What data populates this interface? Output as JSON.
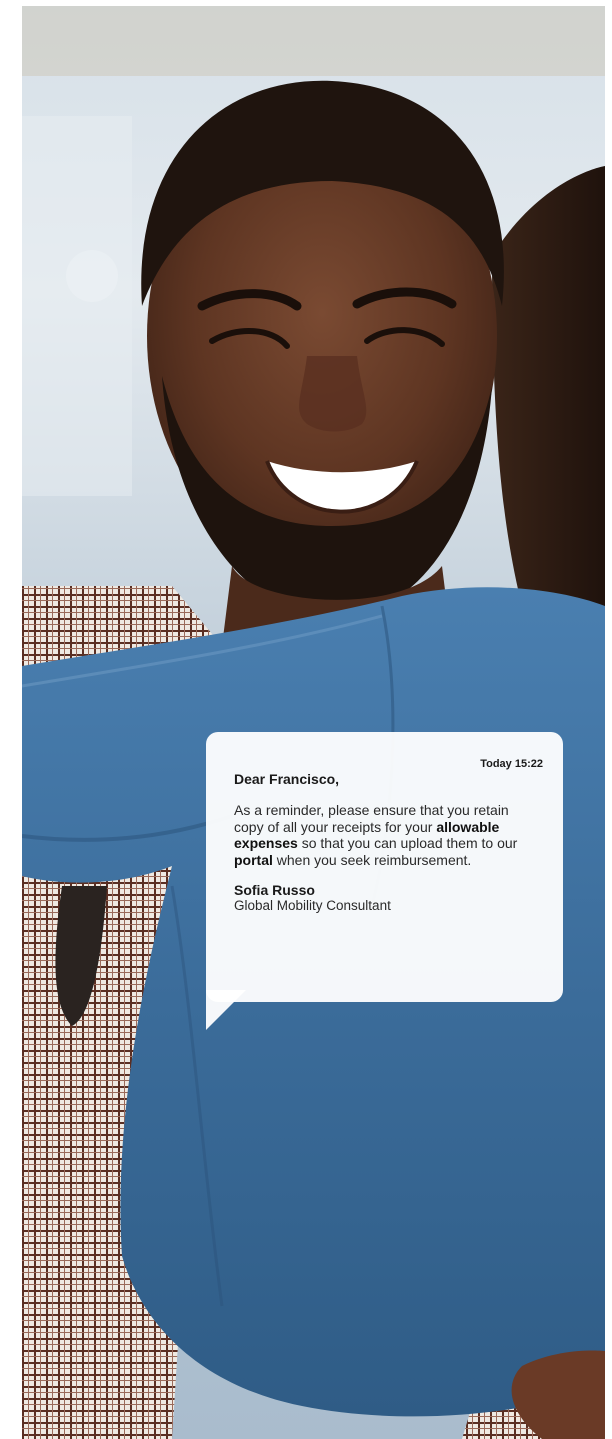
{
  "message": {
    "timestamp": "Today 15:22",
    "greeting": "Dear Francisco,",
    "body_part1": "As a reminder, please ensure that you retain copy of all your receipts for your ",
    "body_bold1": "allowable expenses",
    "body_part2": " so that you can upload them to our ",
    "body_bold2": "portal",
    "body_part3": " when you seek reimbursement.",
    "sender_name": "Sofia Russo",
    "sender_title": "Global Mobility Consultant"
  },
  "colors": {
    "denim": "#3c6e9e",
    "bubble": "#ffffff",
    "text": "#1a1a1a"
  }
}
